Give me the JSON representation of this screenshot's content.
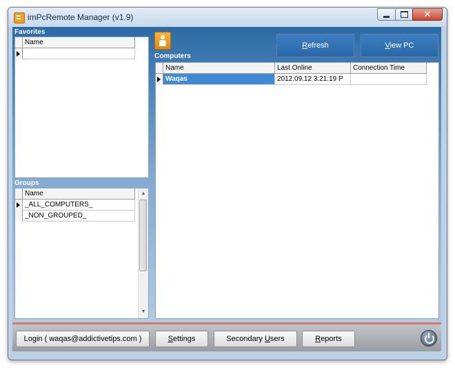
{
  "window": {
    "title": "imPcRemote Manager (v1.9)",
    "buttons": {
      "minimize_icon": "minimize-icon",
      "maximize_icon": "maximize-icon",
      "close_icon": "close-icon",
      "close_glyph": "✕"
    }
  },
  "favorites": {
    "label": "Favorites",
    "columns": [
      "Name"
    ],
    "rows": [
      {
        "name": ""
      }
    ]
  },
  "groups": {
    "label": "Groups",
    "columns": [
      "Name"
    ],
    "rows": [
      {
        "name": "_ALL_COMPUTERS_"
      },
      {
        "name": "_NON_GROUPED_"
      }
    ],
    "scroll_up": "▲",
    "scroll_down": "▼"
  },
  "computers": {
    "label": "Computers",
    "columns": [
      "Name",
      "Last Online",
      "Connection Time"
    ],
    "rows": [
      {
        "name": "Waqas",
        "last_online": "2012.09.12 3:21:19 P",
        "connection_time": ""
      }
    ]
  },
  "toolbar": {
    "refresh_accel": "R",
    "refresh_rest": "efresh",
    "viewpc_accel": "V",
    "viewpc_rest": "iew PC"
  },
  "bottom": {
    "login_label": "Login ( waqas@addictivetips.com )",
    "settings_accel": "S",
    "settings_rest": "ettings",
    "secondary_pre": "Secondary ",
    "secondary_accel": "U",
    "secondary_rest": "sers",
    "reports_accel": "R",
    "reports_rest": "eports",
    "power_icon": "power-icon"
  },
  "colors": {
    "accent_blue": "#2a68a8",
    "selection": "#3e8ad6",
    "bottom_accent": "#d97a66"
  }
}
